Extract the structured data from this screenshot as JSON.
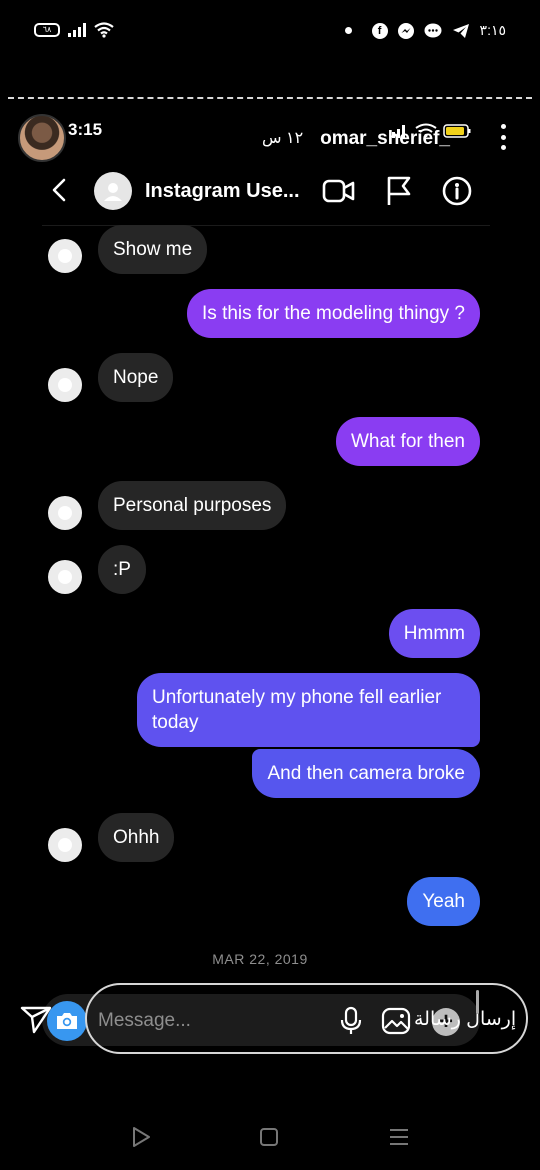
{
  "status_bar": {
    "battery": "٦٨",
    "time": "٣:١٥"
  },
  "story": {
    "time": "3:15",
    "username": "omar_sherief_",
    "ago": "١٢ س"
  },
  "chat_header": {
    "title": "Instagram Use..."
  },
  "messages": [
    {
      "side": "received",
      "text": "Show me"
    },
    {
      "side": "sent",
      "text": "Is this for the modeling thingy ?"
    },
    {
      "side": "received",
      "text": "Nope"
    },
    {
      "side": "sent",
      "text": "What for then"
    },
    {
      "side": "received",
      "text": "Personal purposes"
    },
    {
      "side": "received",
      "text": ":P"
    },
    {
      "side": "sent",
      "text": "Hmmm"
    },
    {
      "side": "sent",
      "text": "Unfortunately my phone fell earlier today"
    },
    {
      "side": "sent",
      "text": "And then camera broke"
    },
    {
      "side": "received",
      "text": "Ohhh"
    },
    {
      "side": "sent",
      "text": "Yeah"
    }
  ],
  "date_stamp": "MAR 22, 2019",
  "composer": {
    "placeholder": "Message...",
    "send_label": "إرسال رسالة"
  },
  "colors": {
    "purple": "#8a3df2",
    "violet": "#6c4ef0",
    "indigo": "#5656ee",
    "blue": "#3f6ff0",
    "received": "#262626"
  }
}
